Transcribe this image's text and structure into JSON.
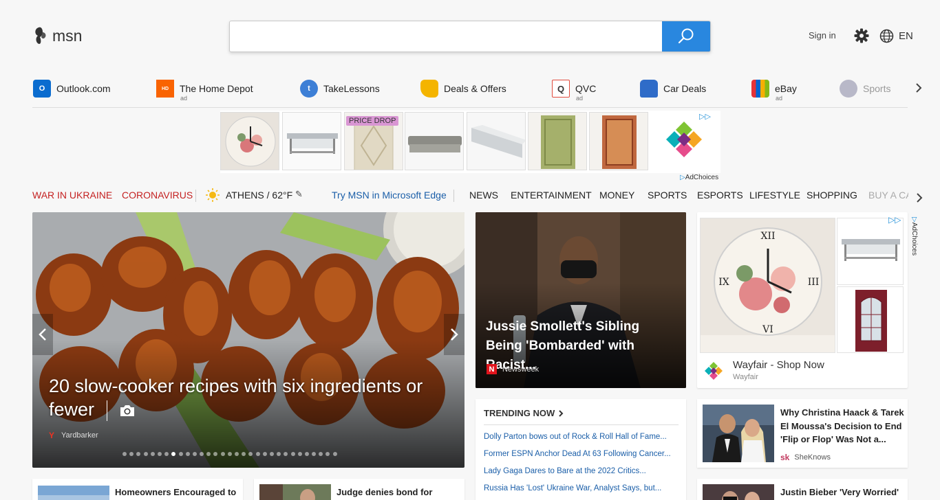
{
  "header": {
    "logo_text": "msn",
    "search": {
      "value": "",
      "placeholder": ""
    },
    "sign_in": "Sign in",
    "language": "EN"
  },
  "quick_links": [
    {
      "label": "Outlook.com",
      "ad": ""
    },
    {
      "label": "The Home Depot",
      "ad": "ad"
    },
    {
      "label": "TakeLessons",
      "ad": ""
    },
    {
      "label": "Deals & Offers",
      "ad": ""
    },
    {
      "label": "QVC",
      "ad": "ad"
    },
    {
      "label": "Car Deals",
      "ad": ""
    },
    {
      "label": "eBay",
      "ad": "ad"
    },
    {
      "label": "Sports",
      "ad": ""
    }
  ],
  "ad_strip": {
    "badge": "PRICE DROP",
    "adchoices": "AdChoices"
  },
  "nav": {
    "war": "War in Ukraine",
    "corona": "Coronavirus",
    "weather": "Athens / 62°F",
    "edge": "Try MSN in Microsoft Edge",
    "items": [
      "News",
      "Entertainment",
      "Money",
      "Sports",
      "Esports",
      "Lifestyle",
      "Shopping",
      "Buy a ca"
    ]
  },
  "hero": {
    "title": "20 slow-cooker recipes with six ingredients or fewer",
    "source": "Yardbarker",
    "slides_total": 31,
    "slide_active": 7
  },
  "story2": {
    "title": "Jussie Smollett's Sibling Being 'Bombarded' with Racist...",
    "source": "Newsweek"
  },
  "ad_card": {
    "title": "Wayfair - Shop Now",
    "sponsor": "Wayfair",
    "adchoices": "AdChoices"
  },
  "trending": {
    "header": "TRENDING NOW",
    "items": [
      "Dolly Parton bows out of Rock & Roll Hall of Fame...",
      "Former ESPN Anchor Dead At 63 Following Cancer...",
      "Lady Gaga Dares to Bare at the 2022 Critics...",
      "Russia Has 'Lost' Ukraine War, Analyst Says, but..."
    ]
  },
  "story3": {
    "title": "Why Christina Haack & Tarek El Moussa's Decision to End 'Flip or Flop' Was Not a...",
    "source": "SheKnows"
  },
  "story4": {
    "title": "Justin Bieber 'Very Worried'"
  },
  "story5": {
    "title": "Homeowners Encouraged to"
  },
  "story6": {
    "title": "Judge denies bond for"
  },
  "colors": {
    "accent": "#2987df",
    "nav_red": "#c42121",
    "link_blue": "#1a5ea8"
  }
}
